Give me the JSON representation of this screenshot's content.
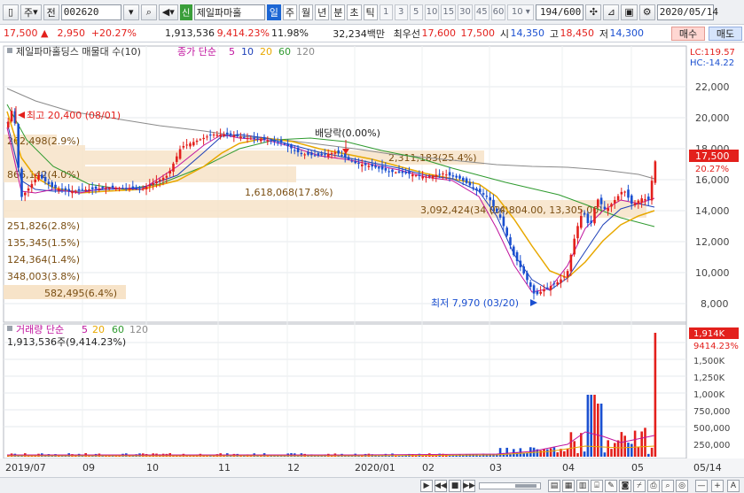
{
  "toolbar": {
    "type_label": "주",
    "market_label": "전",
    "code": "002620",
    "name_badge": "신",
    "stock_name": "제일파마홀",
    "periods": [
      "일",
      "주",
      "월",
      "년",
      "분",
      "초",
      "틱"
    ],
    "active_period": "일",
    "numbers": [
      "1",
      "3",
      "5",
      "10",
      "15",
      "30",
      "45",
      "60"
    ],
    "interval_value": "10",
    "counter": "194",
    "counter_total": "/600",
    "date": "2020/05/14"
  },
  "quote": {
    "price": "17,500",
    "change": "2,950",
    "change_pct": "+20.27%",
    "volume": "1,913,536",
    "volume_pct": "9,414.23%",
    "turnover": "11.98%",
    "amount": "32,234백만",
    "best_label": "최우선",
    "best_ask": "17,600",
    "best_bid": "17,500",
    "open_label": "시",
    "open": "14,350",
    "high_label": "고",
    "high": "18,450",
    "low_label": "저",
    "low": "14,300",
    "buy_label": "매수",
    "sell_label": "매도"
  },
  "legend": {
    "name": "제일파마홀딩스 매물대 수(10)",
    "ma_title": "종가 단순",
    "ma_periods": [
      "5",
      "10",
      "20",
      "60",
      "120"
    ],
    "lc": "LC:119.57",
    "hc": "HC:-14.22"
  },
  "vol_legend": {
    "title": "거래량 단순",
    "ma_periods": [
      "5",
      "20",
      "60",
      "120"
    ],
    "value": "1,913,536주(9,414.23%)"
  },
  "annotations": {
    "high": "최고 20,400 (08/01)",
    "low": "최저 7,970 (03/20)",
    "dividend": "배당락(0.00%)",
    "current_price": "17,500",
    "current_pct": "20.27%",
    "current_vol": "1,914K",
    "current_vol_pct": "9414.23%"
  },
  "volume_profile": [
    {
      "label": "262,498(2.9%)"
    },
    {
      "label": "866,142(4.0%)"
    },
    {
      "label": "1,618,068(17.8%)"
    },
    {
      "label": "2,311,183(25.4%)"
    },
    {
      "label": "3,092,424(34.0%)"
    },
    {
      "label": "251,826(2.8%)"
    },
    {
      "label": "135,345(1.5%)"
    },
    {
      "label": "124,364(1.4%)"
    },
    {
      "label": "348,003(3.8%)"
    },
    {
      "label": "582,495(6.4%)"
    }
  ],
  "crosshair_label": "(14,804.00, 13,305.00)",
  "price_axis": [
    "22,000",
    "20,000",
    "18,000",
    "16,000",
    "14,000",
    "12,000",
    "10,000",
    "8,000"
  ],
  "volume_axis": [
    "1,500K",
    "1,250K",
    "1,000K",
    "750,000",
    "500,000",
    "250,000"
  ],
  "date_axis": [
    "2019/07",
    "09",
    "10",
    "11",
    "12",
    "2020/01",
    "02",
    "03",
    "04",
    "05"
  ],
  "axis_corner": "05/14",
  "colors": {
    "up": "#e3201c",
    "down": "#1a4fd0",
    "ma5": "#c0139e",
    "ma10": "#1d3fb8",
    "ma20": "#e8a800",
    "ma60": "#2e9a2e",
    "ma120": "#8a8a8a",
    "profile": "#f7e3c8"
  }
}
